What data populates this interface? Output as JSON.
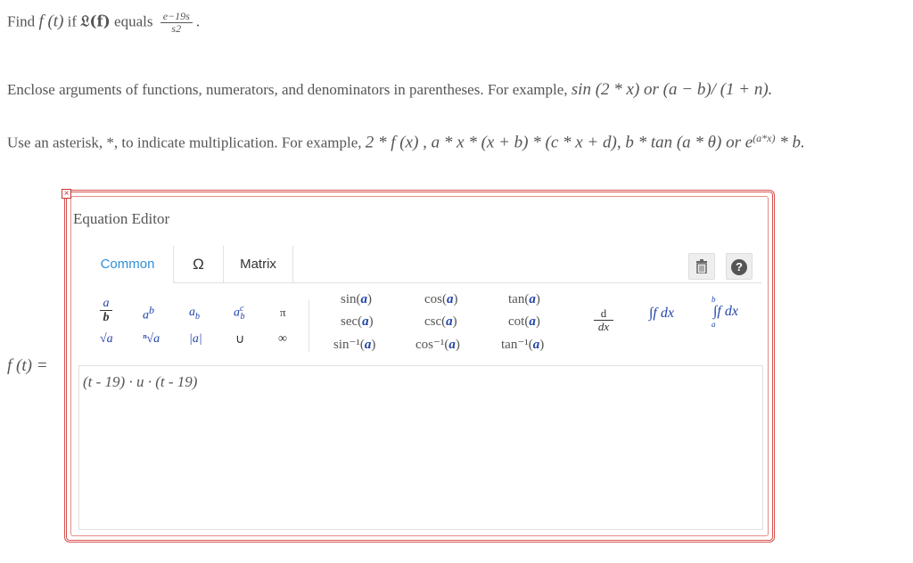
{
  "question": {
    "line1_prefix": "Find",
    "line1_func": "f (t)",
    "line1_if": "if",
    "line1_transform": "𝔏(f)",
    "line1_equals": "equals",
    "line1_frac_num": "e−19s",
    "line1_frac_den": "s2",
    "line1_end": ".",
    "line2_text": "Enclose arguments of functions, numerators, and denominators in parentheses. For example,",
    "line2_example": "sin (2 * x) or (a − b)/ (1 + n).",
    "line3_text": "Use an asterisk, *, to indicate multiplication. For example,",
    "line3_example": "2 * f (x) , a * x * (x + b) * (c * x + d),  b * tan (a * θ)  or e",
    "line3_exp": "(a*x)",
    "line3_tail": " * b."
  },
  "editor": {
    "close_label": "×",
    "title": "Equation Editor",
    "tabs": [
      "Common",
      "Ω",
      "Matrix"
    ],
    "trash_icon": "trash-icon",
    "help_label": "?",
    "palette": {
      "frac_num": "a",
      "frac_den": "b",
      "power": "a",
      "power_sup": "b",
      "subscript": "a",
      "subscript_sub": "b",
      "subsup": "a",
      "subsup_sup": "c",
      "subsup_sub": "b",
      "pi": "π",
      "sqrt": "√a",
      "nthroot": "ⁿ√a",
      "abs": "|a|",
      "union": "∪",
      "infinity": "∞",
      "trig_col1": [
        "sin(",
        "sec(",
        "sin⁻¹("
      ],
      "trig_col2": [
        "cos(",
        "csc(",
        "cos⁻¹("
      ],
      "trig_col3": [
        "tan(",
        "cot(",
        "tan⁻¹("
      ],
      "arg": "a",
      "close_paren": ")",
      "deriv_num": "d",
      "deriv_den": "dx",
      "integral": "∫f dx",
      "def_integral": "∫f dx",
      "def_upper": "b",
      "def_lower": "a"
    },
    "answer_label": "f (t) =",
    "answer_expr": "(t - 19) · u · (t - 19)"
  }
}
